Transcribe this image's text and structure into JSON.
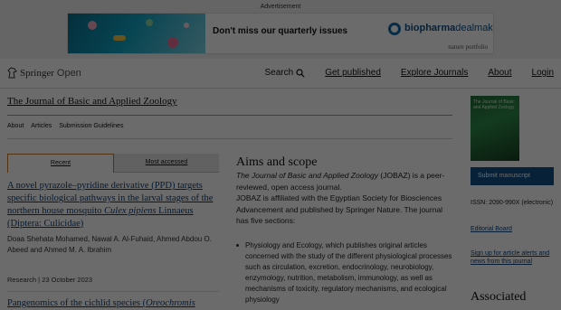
{
  "ad": {
    "label": "Advertisement",
    "text": "Don't miss our quarterly issues",
    "brand_bold": "biopharma",
    "brand_rest": "dealmakers",
    "publisher": "nature portfolio"
  },
  "header": {
    "logo_a": "Springer",
    "logo_b": "Open",
    "nav": {
      "search": "Search",
      "get_published": "Get published",
      "explore": "Explore Journals",
      "about": "About",
      "login": "Login"
    }
  },
  "journal": {
    "title": "The Journal of Basic and Applied Zoology",
    "subnav": [
      "About",
      "Articles",
      "Submission Guidelines"
    ],
    "cover_title": "The Journal of Basic and Applied Zoology"
  },
  "tabs": {
    "recent": "Recent",
    "most_accessed": "Most accessed"
  },
  "article": {
    "title_a": "A novel pyrazole–pyridine derivative (PPD) targets specific biological pathways in the larval stages of the northern house mosquito ",
    "title_em": "Culex pipiens",
    "title_b": " Linnaeus (Diptera: Culicidae)",
    "authors": "Doaa Shehata Mohamed, Nawal A. Al-Fuhaid, Ahmed Abdou O. Abeed and Ahmed M. A. Ibrahim",
    "meta": "Research | 23 October 2023",
    "next_title_a": "Pangenomics of the cichlid species (",
    "next_title_em": "Oreochromis"
  },
  "aims": {
    "heading": "Aims and scope",
    "para_em": "The Journal of Basic and Applied Zoology",
    "para_rest": " (JOBAZ) is a peer-reviewed, open access journal.",
    "para2": "JOBAZ is affiliated with the Egyptian Society for Biosciences Advancement and published by Springer Nature. The journal has five sections:",
    "bullet1": "Physiology and Ecology, which publishes original articles concerned with the study of the different physiological processes such as circulation, excretion, endocrinology, neurobiology, enzymology, nutrition, metabolism, immunology, as well as mechanisms of toxicity, regulatory mechanisms, and ecological physiology"
  },
  "sidebar": {
    "submit": "Submit manuscript",
    "issn": "ISSN: 2090-990X (electronic)",
    "editorial": "Editorial Board",
    "signup": "Sign up for article alerts and news from this journal",
    "associated": "Associated"
  },
  "colors": {
    "brand_blue": "#0f4f86",
    "link": "#0c3f7a",
    "tab_accent": "#c07a2a"
  }
}
